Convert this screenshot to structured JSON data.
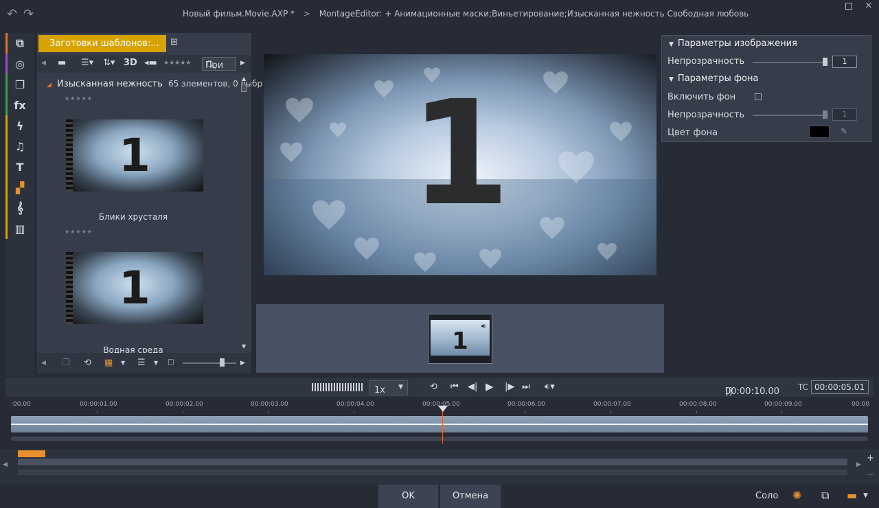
{
  "titlebar": {
    "project": "Новый фильм.Movie.AXP",
    "modified_mark": "*",
    "separator": ">",
    "editor_title": "MontageEditor: + Анимационные маски;Виньетирование;Изысканная нежность  Свободная любовь"
  },
  "rail": {
    "items": [
      {
        "icon": "box-icon",
        "glyph": "⧉",
        "color": "#e8702a"
      },
      {
        "icon": "film-reel-icon",
        "glyph": "◎",
        "color": "#9b4fc9"
      },
      {
        "icon": "media-stack-icon",
        "glyph": "❐",
        "color": "#3aa34a"
      },
      {
        "icon": "fx-icon",
        "glyph": "fx",
        "color": "#3aa34a"
      },
      {
        "icon": "lightning-icon",
        "glyph": "ϟ",
        "color": "#d6a300"
      },
      {
        "icon": "music-note-icon",
        "glyph": "♫",
        "color": "#d6a300"
      },
      {
        "icon": "text-icon",
        "glyph": "T",
        "color": "#d6a300"
      },
      {
        "icon": "montage-icon",
        "glyph": "▞",
        "color": "#d6a300"
      },
      {
        "icon": "treble-clef-icon",
        "glyph": "𝄞",
        "color": "#d6a300"
      },
      {
        "icon": "piano-icon",
        "glyph": "▥",
        "color": "#d6a300"
      }
    ]
  },
  "library": {
    "tab_label": "Заготовки шаблонов:...",
    "toolbar": {
      "mode_3d": "3D",
      "rating_filter": "★★★★★",
      "search_placeholder": "Пои"
    },
    "group": {
      "name": "Изысканная нежность",
      "count": "65 элементов, 0 выбр"
    },
    "items": [
      {
        "label": "Блики хрусталя",
        "rating": "★★★★★",
        "number": "1"
      },
      {
        "label": "Водная среда",
        "rating": "★★★★★",
        "number": "1"
      }
    ]
  },
  "preview": {
    "number": "1"
  },
  "strip": {
    "number": "1"
  },
  "properties": {
    "image_section": "Параметры изображения",
    "image_opacity_label": "Непрозрачность",
    "image_opacity_value": "1",
    "background_section": "Параметры фона",
    "enable_background_label": "Включить фон",
    "bg_opacity_label": "Непрозрачность",
    "bg_opacity_value": "1",
    "bg_color_label": "Цвет фона",
    "bg_color": "#000000"
  },
  "transport": {
    "speed": "1x",
    "duration_bracket": "[]",
    "duration": "00:00:10.00",
    "tc_label": "TC",
    "tc_value": "00:00:05.01"
  },
  "ruler": {
    "ticks": [
      ":00.00",
      "00:00:01.00",
      "00:00:02.00",
      "00:00:03.00",
      "00:00:04.00",
      "00:00:05.00",
      "00:00:06.00",
      "00:00:07.00",
      "00:00:08.00",
      "00:00:09.00",
      "00:00"
    ]
  },
  "footer": {
    "ok_label": "OK",
    "cancel_label": "Отмена",
    "solo_label": "Соло"
  },
  "colors": {
    "accent": "#d6a300",
    "playhead": "#e06a2a",
    "marker": "#e8912e"
  }
}
